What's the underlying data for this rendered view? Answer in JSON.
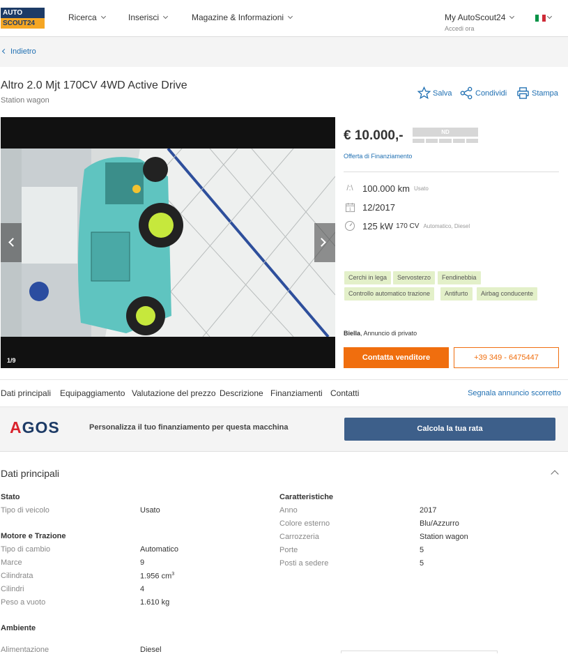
{
  "header": {
    "logo_top": "AUTO",
    "logo_bottom": "SCOUT24",
    "nav": [
      "Ricerca",
      "Inserisci",
      "Magazine & Informazioni"
    ],
    "account_label": "My AutoScout24",
    "account_sub": "Accedi ora"
  },
  "back_label": "Indietro",
  "listing": {
    "title": "Altro 2.0 Mjt 170CV 4WD Active Drive",
    "body_type": "Station wagon",
    "actions": {
      "save": "Salva",
      "share": "Condividi",
      "print": "Stampa"
    },
    "gallery_counter": "1/9",
    "price": "€ 10.000,-",
    "price_rating": "ND",
    "finance_link": "Offerta di Finanziamento",
    "mileage": "100.000 km",
    "mileage_note": "Usato",
    "registration": "12/2017",
    "power": "125 kW",
    "power_cv": "170 CV",
    "power_note": "Automatico, Diesel",
    "features": [
      "Cerchi in lega",
      "Servosterzo",
      "Fendinebbia",
      "Controllo automatico trazione",
      "Antifurto",
      "Airbag conducente"
    ],
    "seller_city": "Biella",
    "seller_type": ", Annuncio di privato",
    "contact_button": "Contatta venditore",
    "phone_button": "+39 349 - 6475447"
  },
  "tabs": [
    "Dati principali",
    "Equipaggiamento",
    "Valutazione del prezzo",
    "Descrizione",
    "Finanziamenti",
    "Contatti"
  ],
  "report_link": "Segnala annuncio scorretto",
  "agos": {
    "logo": "AGOS",
    "text": "Personalizza il tuo finanziamento per questa macchina",
    "button": "Calcola la tua rata"
  },
  "details": {
    "title": "Dati principali",
    "stato": {
      "heading": "Stato",
      "rows": [
        [
          "Tipo di veicolo",
          "Usato"
        ]
      ]
    },
    "motore": {
      "heading": "Motore e Trazione",
      "rows": [
        [
          "Tipo di cambio",
          "Automatico"
        ],
        [
          "Marce",
          "9"
        ],
        [
          "Cilindrata",
          "1.956 cm"
        ],
        [
          "Cilindri",
          "4"
        ],
        [
          "Peso a vuoto",
          "1.610 kg"
        ]
      ]
    },
    "ambiente": {
      "heading": "Ambiente",
      "rows": [
        [
          "Alimentazione",
          "Diesel"
        ]
      ]
    },
    "caratteristiche": {
      "heading": "Caratteristiche",
      "rows": [
        [
          "Anno",
          "2017"
        ],
        [
          "Colore esterno",
          "Blu/Azzurro"
        ],
        [
          "Carrozzeria",
          "Station wagon"
        ],
        [
          "Porte",
          "5"
        ],
        [
          "Posti a sedere",
          "5"
        ]
      ]
    },
    "cc_superscript": "3"
  },
  "colors": {
    "brand_blue": "#1d3b66",
    "orange": "#f06e0e",
    "link": "#1f6fb2",
    "feature_bg": "#e3f0c9"
  }
}
